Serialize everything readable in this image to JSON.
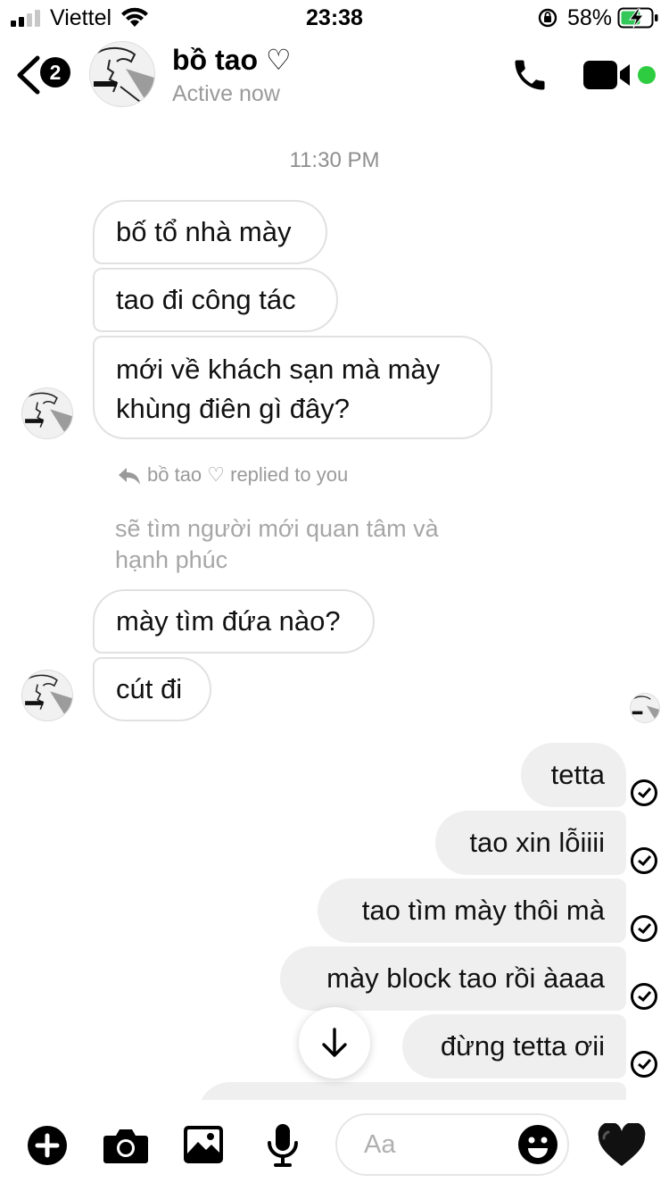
{
  "status_bar": {
    "carrier": "Viettel",
    "time": "23:38",
    "battery": "58%"
  },
  "header": {
    "unread_count": "2",
    "contact_name": "bồ tao ♡",
    "contact_status": "Active now"
  },
  "conversation": {
    "timestamp": "11:30 PM",
    "incoming_group_1": [
      "bố tổ nhà mày",
      "tao đi công tác",
      "mới về khách sạn mà mày",
      "khùng điên gì đây?"
    ],
    "reply_label": "bồ tao ♡ replied to you",
    "quoted_message": "sẽ tìm người mới quan tâm và hạnh phúc",
    "incoming_group_2": [
      "mày tìm đứa nào?",
      "cút đi"
    ],
    "outgoing": [
      "tetta",
      "tao xin lỗiiii",
      "tao tìm mày thôi mà",
      "mày block tao rồi àaaa",
      "đừng tetta ơii"
    ]
  },
  "composer": {
    "placeholder": "Aa"
  },
  "colors": {
    "outgoing_bubble": "#efefef",
    "incoming_border": "#e1e1e1",
    "active_dot": "#2ecc40",
    "battery_fill": "#34c759"
  },
  "icons": [
    "signal-icon",
    "wifi-icon",
    "lock-rotation-icon",
    "battery-icon",
    "back-chevron-icon",
    "phone-icon",
    "video-icon",
    "reply-arrow-icon",
    "arrow-down-icon",
    "plus-icon",
    "camera-icon",
    "gallery-icon",
    "mic-icon",
    "emoji-icon",
    "heart-icon",
    "read-check-icon"
  ]
}
